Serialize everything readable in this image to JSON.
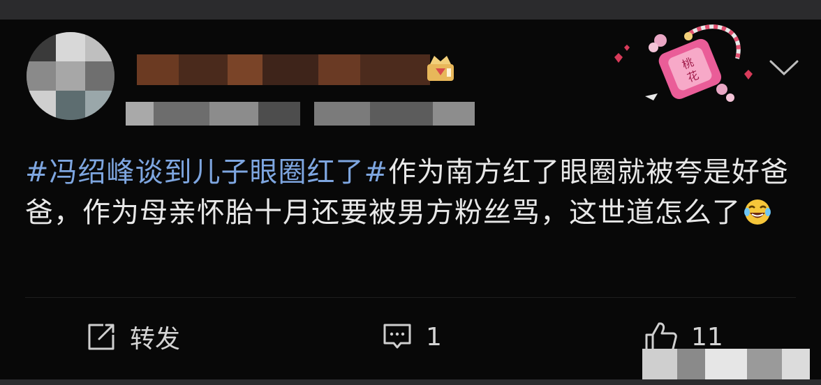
{
  "post": {
    "topic": "#冯绍峰谈到儿子眼圈红了#",
    "body": "作为南方红了眼圈就被夸是好爸爸，作为母亲怀胎十月还要被男方粉丝骂，这世道怎么了",
    "emoji": "laughing-tears-emoji"
  },
  "actions": {
    "repost_label": "转发",
    "comment_count": "1",
    "like_count": "11"
  },
  "icons": {
    "repost": "repost-icon",
    "comment": "comment-icon",
    "like": "thumbs-up-icon",
    "more": "chevron-down-icon",
    "badge": "crown-badge-icon",
    "decoration": "peach-blossom-pendant"
  },
  "colors": {
    "background": "#080808",
    "topic": "#7ea6e0",
    "text": "#e8e8e8",
    "icon": "#cfcfcf"
  }
}
